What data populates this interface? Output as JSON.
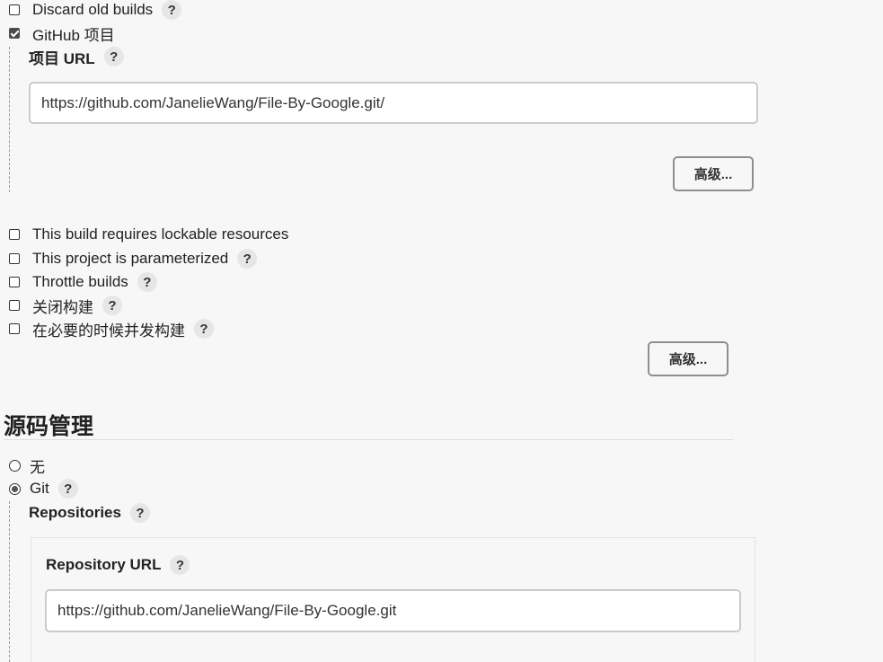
{
  "general": {
    "discard_old_builds": {
      "label": "Discard old builds",
      "checked": false,
      "help": "?"
    },
    "github_project": {
      "label": "GitHub 项目",
      "checked": true
    },
    "project_url": {
      "label": "项目 URL",
      "help": "?",
      "value": "https://github.com/JanelieWang/File-By-Google.git/"
    },
    "advanced_button_1": "高级...",
    "lockable_resources": {
      "label": "This build requires lockable resources",
      "checked": false
    },
    "parameterized": {
      "label": "This project is parameterized",
      "checked": false,
      "help": "?"
    },
    "throttle_builds": {
      "label": "Throttle builds",
      "checked": false,
      "help": "?"
    },
    "disable_build": {
      "label": "关闭构建",
      "checked": false,
      "help": "?"
    },
    "concurrent_build": {
      "label": "在必要的时候并发构建",
      "checked": false,
      "help": "?"
    },
    "advanced_button_2": "高级..."
  },
  "scm": {
    "title": "源码管理",
    "none_option": {
      "label": "无",
      "selected": false
    },
    "git_option": {
      "label": "Git",
      "selected": true,
      "help": "?"
    },
    "repositories": {
      "label": "Repositories",
      "help": "?"
    },
    "repository_url": {
      "label": "Repository URL",
      "help": "?",
      "value": "https://github.com/JanelieWang/File-By-Google.git"
    }
  }
}
